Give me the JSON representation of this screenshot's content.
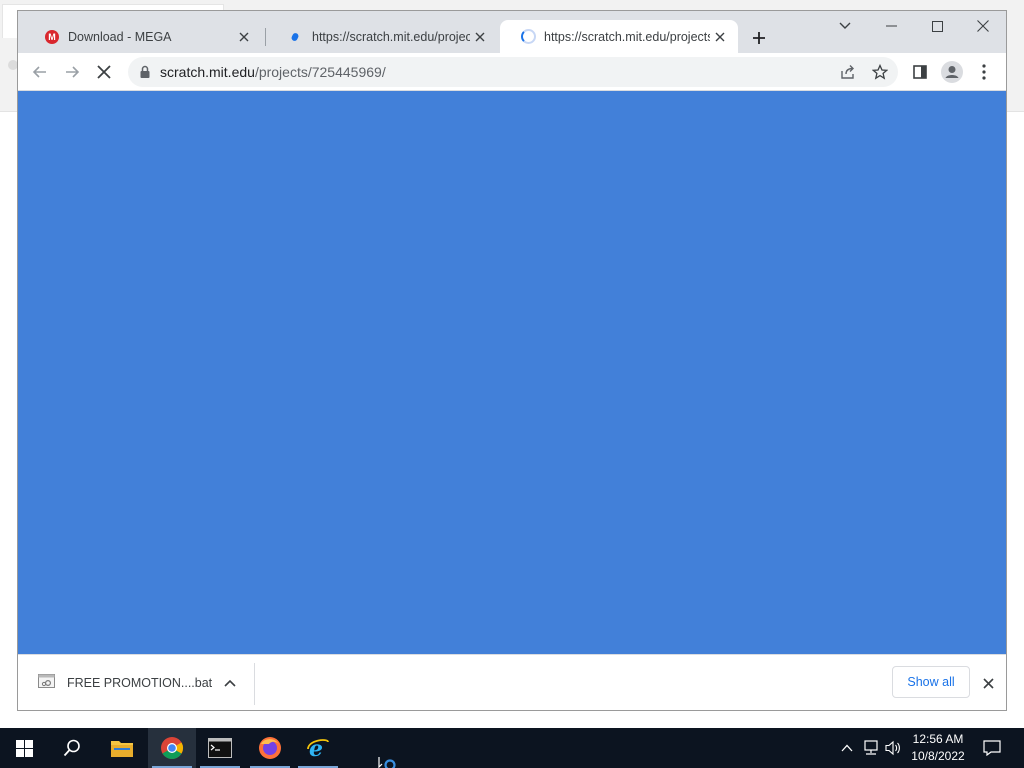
{
  "browser": {
    "tabs": [
      {
        "title": "Download - MEGA",
        "favicon": "mega-logo"
      },
      {
        "title": "https://scratch.mit.edu/projects/",
        "favicon": "scratch-favicon"
      },
      {
        "title": "https://scratch.mit.edu/projects/",
        "favicon": "loading-spinner",
        "active": true
      }
    ],
    "address": {
      "domain": "scratch.mit.edu",
      "path": "/projects/725445969/"
    },
    "content_color": "#4280d9"
  },
  "download_shelf": {
    "file_name": "FREE PROMOTION....bat",
    "show_all_label": "Show all"
  },
  "taskbar": {
    "apps": [
      "windows-start",
      "search",
      "file-explorer",
      "chrome",
      "command-prompt",
      "firefox",
      "internet-explorer"
    ],
    "time": "12:56 AM",
    "date": "10/8/2022"
  }
}
